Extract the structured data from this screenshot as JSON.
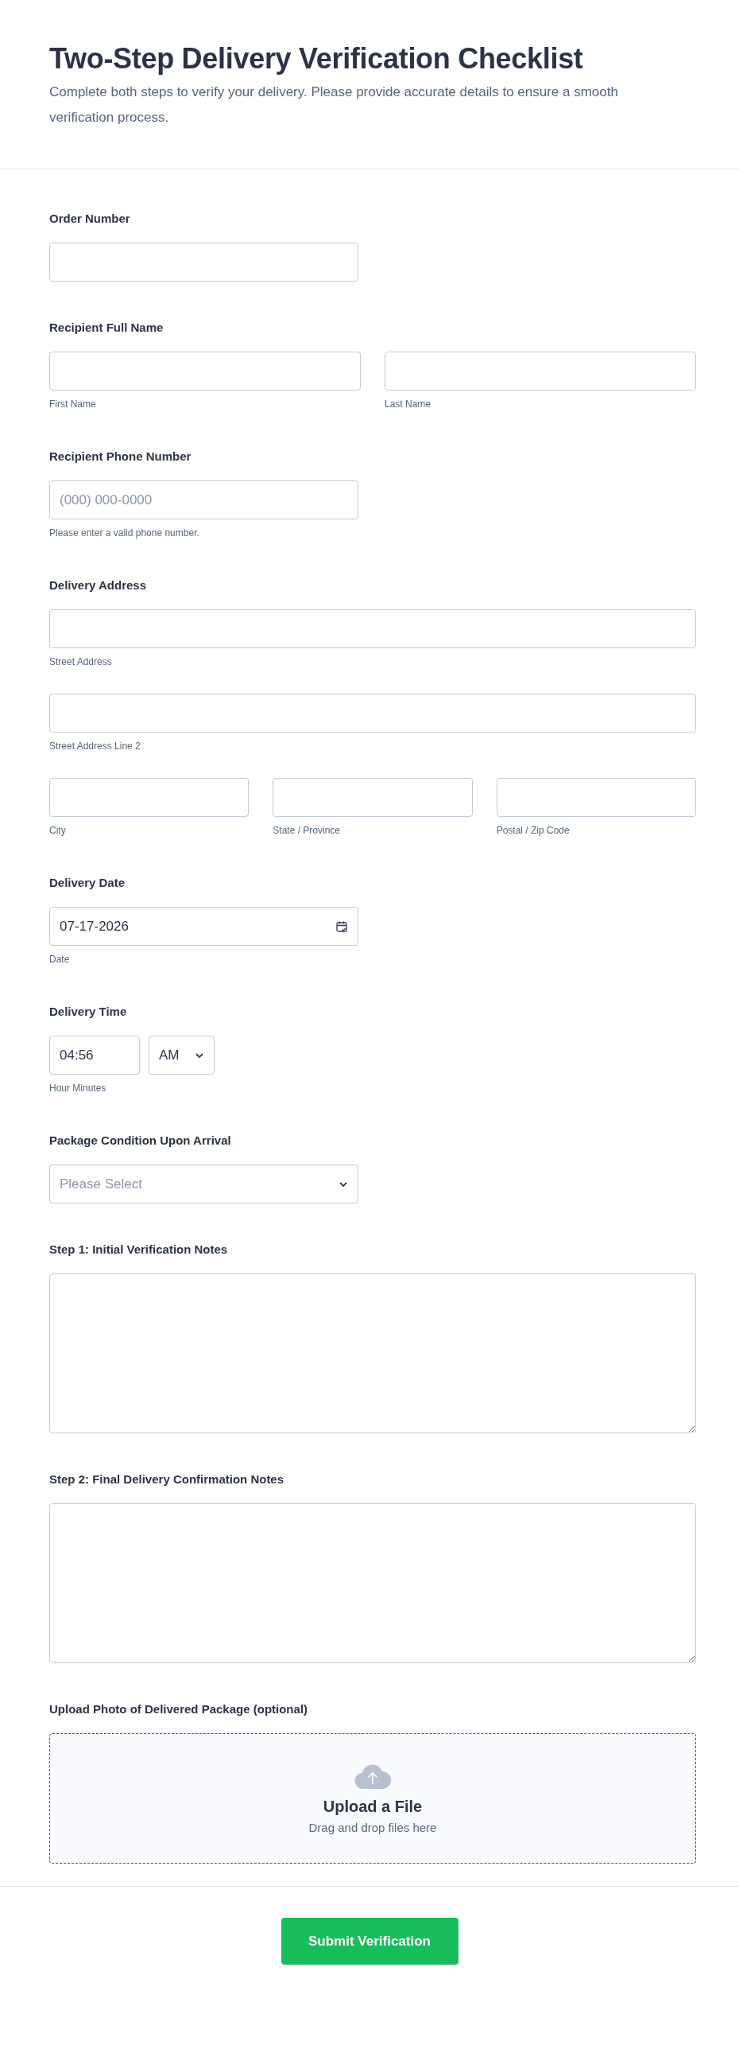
{
  "header": {
    "title": "Two-Step Delivery Verification Checklist",
    "description": "Complete both steps to verify your delivery. Please provide accurate details to ensure a smooth verification process."
  },
  "fields": [
    {
      "kind": "input",
      "label": "Order Number"
    },
    {
      "kind": "group",
      "label": "Recipient Full Name",
      "rows": [
        [
          {
            "sublabel": "First Name"
          },
          {
            "sublabel": "Last Name"
          }
        ]
      ]
    },
    {
      "kind": "input",
      "label": "Recipient Phone Number",
      "placeholder": "(000) 000-0000",
      "sublabel": "Please enter a valid phone number."
    },
    {
      "kind": "group",
      "label": "Delivery Address",
      "rows": [
        [
          {
            "sublabel": "Street Address"
          }
        ],
        [
          {
            "sublabel": "Street Address Line 2"
          }
        ],
        [
          {
            "sublabel": "City"
          },
          {
            "sublabel": "State / Province"
          },
          {
            "sublabel": "Postal / Zip Code"
          }
        ]
      ]
    },
    {
      "kind": "date",
      "label": "Delivery Date",
      "value": "07-17-2026",
      "sublabel": "Date"
    },
    {
      "kind": "time",
      "label": "Delivery Time",
      "value": "04:56",
      "period": "AM",
      "sublabel": "Hour Minutes"
    },
    {
      "kind": "select",
      "label": "Package Condition Upon Arrival",
      "placeholder": "Please Select"
    },
    {
      "kind": "textarea",
      "label": "Step 1: Initial Verification Notes"
    },
    {
      "kind": "textarea",
      "label": "Step 2: Final Delivery Confirmation Notes"
    },
    {
      "kind": "upload",
      "label": "Upload Photo of Delivered Package (optional)",
      "title": "Upload a File",
      "hint": "Drag and drop files here"
    }
  ],
  "submit": {
    "label": "Submit Verification"
  }
}
